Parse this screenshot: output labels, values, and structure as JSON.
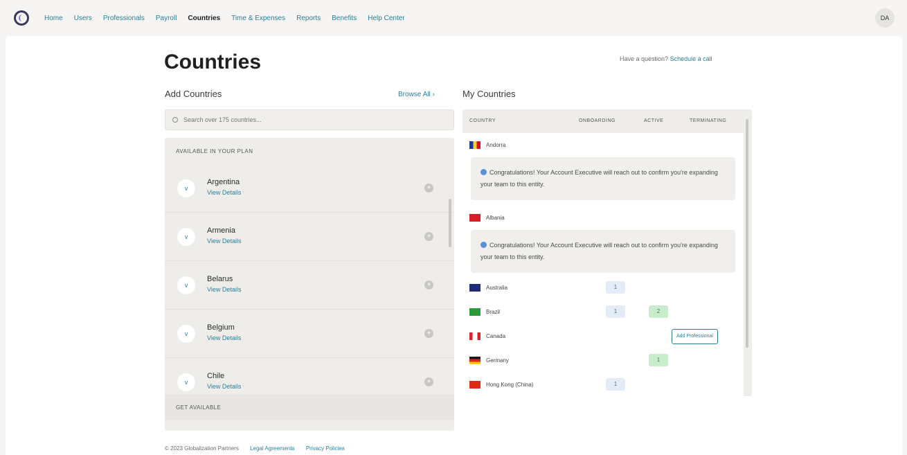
{
  "nav": {
    "items": [
      "Home",
      "Users",
      "Professionals",
      "Payroll",
      "Countries",
      "Time & Expenses",
      "Reports",
      "Benefits",
      "Help Center"
    ],
    "active": "Countries",
    "avatar": "DA"
  },
  "header": {
    "title": "Countries",
    "help_prefix": "Have a question?",
    "help_link": "Schedule a call"
  },
  "add_section": {
    "title": "Add Countries",
    "browse": "Browse All",
    "browse_chevron": "›",
    "search_placeholder": "Search over 175 countries...",
    "group_label": "Available in your plan",
    "countries": [
      {
        "name": "Argentina",
        "link": "View Details"
      },
      {
        "name": "Armenia",
        "link": "View Details"
      },
      {
        "name": "Belarus",
        "link": "View Details"
      },
      {
        "name": "Belgium",
        "link": "View Details"
      },
      {
        "name": "Chile",
        "link": "View Details"
      }
    ],
    "other_label": "Get Available"
  },
  "my_section": {
    "title": "My Countries",
    "columns": [
      "Country",
      "Onboarding",
      "Active",
      "Terminating"
    ],
    "rows": [
      {
        "name": "Andorra",
        "notice": "Congratulations! Your Account Executive will reach out to confirm you're expanding your team to this entity."
      },
      {
        "name": "Albania",
        "notice": "Congratulations! Your Account Executive will reach out to confirm you're expanding your team to this entity."
      },
      {
        "name": "Australia",
        "onboarding": "1"
      },
      {
        "name": "Brazil",
        "onboarding": "1",
        "active": "2"
      },
      {
        "name": "Canada",
        "action": "Add Professional"
      },
      {
        "name": "Germany",
        "active": "1"
      },
      {
        "name": "Hong Kong (China)",
        "onboarding": "1"
      }
    ]
  },
  "footer": {
    "copyright": "© 2023 Globalization Partners",
    "legal": "Legal Agreements",
    "privacy": "Privacy Policies"
  },
  "colors": {
    "accent": "#2c7e94",
    "onboarding_pill": "#e3ecf7",
    "active_pill": "#c9eccf",
    "notice_dot": "#5a8fd6"
  }
}
